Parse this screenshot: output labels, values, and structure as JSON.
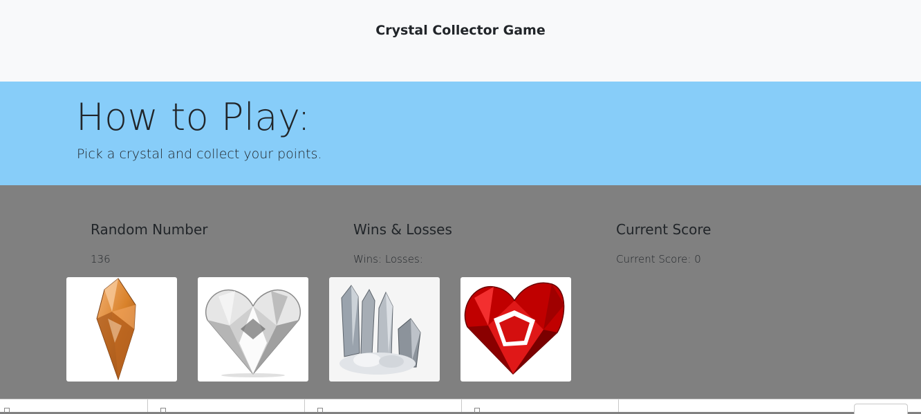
{
  "navbar": {
    "title": "Crystal Collector Game"
  },
  "jumbotron": {
    "title": "How to Play:",
    "lead": "Pick a crystal and collect your points."
  },
  "stats": {
    "random_number": {
      "heading": "Random Number",
      "value": "136"
    },
    "wins_losses": {
      "heading": "Wins & Losses",
      "text": "Wins: Losses:"
    },
    "current_score": {
      "heading": "Current Score",
      "text": "Current Score: 0"
    }
  },
  "crystals": [
    {
      "name": "orange-crystal-icon"
    },
    {
      "name": "diamond-heart-icon"
    },
    {
      "name": "quartz-cluster-icon"
    },
    {
      "name": "ruby-heart-icon"
    }
  ],
  "colors": {
    "navbar_bg": "#f8f9fa",
    "jumbotron_bg": "#87cdf9",
    "game_bg": "#808080",
    "card_bg": "#ffffff",
    "ruby": "#c00000",
    "amber": "#d9822b"
  }
}
